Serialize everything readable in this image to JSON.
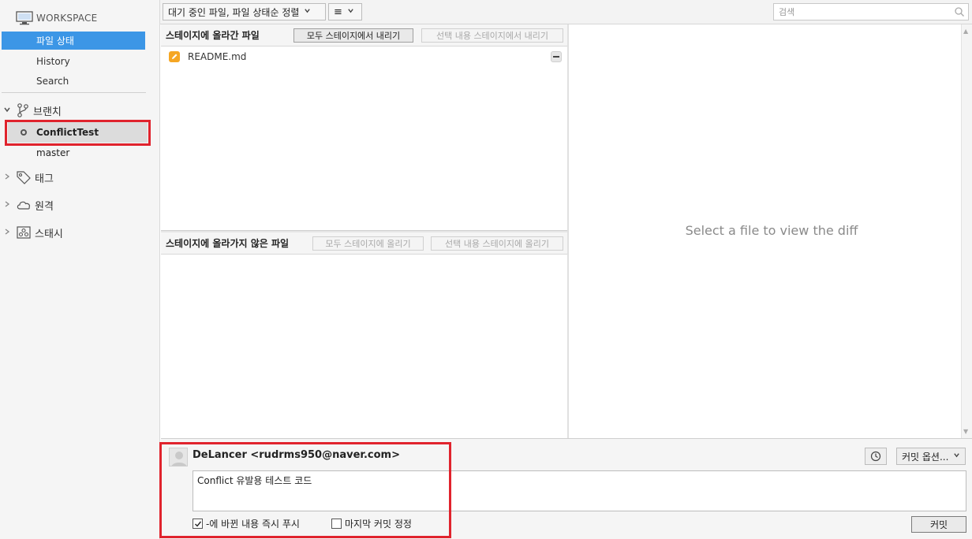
{
  "sidebar": {
    "workspace_label": "WORKSPACE",
    "workspace_items": [
      {
        "label": "파일 상태",
        "selected": true
      },
      {
        "label": "History",
        "selected": false
      },
      {
        "label": "Search",
        "selected": false
      }
    ],
    "branches": {
      "label": "브랜치",
      "items": [
        {
          "label": "ConflictTest",
          "current": true
        },
        {
          "label": "master",
          "current": false
        }
      ]
    },
    "tags_label": "태그",
    "remotes_label": "원격",
    "stashes_label": "스태시"
  },
  "toolbar": {
    "filter_sort_label": "대기 중인 파일, 파일 상태순 정렬",
    "view_mode_glyph": "≡",
    "search_placeholder": "검색"
  },
  "staged": {
    "title": "스테이지에 올라간 파일",
    "unstage_all_label": "모두 스테이지에서 내리기",
    "unstage_selected_label": "선택 내용 스테이지에서 내리기",
    "files": [
      {
        "name": "README.md",
        "status": "modified"
      }
    ]
  },
  "unstaged": {
    "title": "스테이지에 올라가지 않은 파일",
    "stage_all_label": "모두 스테이지에 올리기",
    "stage_selected_label": "선택 내용 스테이지에 올리기",
    "files": []
  },
  "diff": {
    "placeholder": "Select a file to view the diff"
  },
  "commit": {
    "author": "DeLancer <rudrms950@naver.com>",
    "message": "Conflict 유발용 테스트 코드",
    "options_label": "커밋 옵션...",
    "push_checkbox_label": "-에 바뀐 내용 즉시 푸시",
    "push_checked": true,
    "amend_checkbox_label": "마지막 커밋 정정",
    "amend_checked": false,
    "commit_button_label": "커밋"
  },
  "colors": {
    "selection_blue": "#3c96e6",
    "highlight_red": "#e0232d",
    "modified_orange": "#f5a623"
  }
}
